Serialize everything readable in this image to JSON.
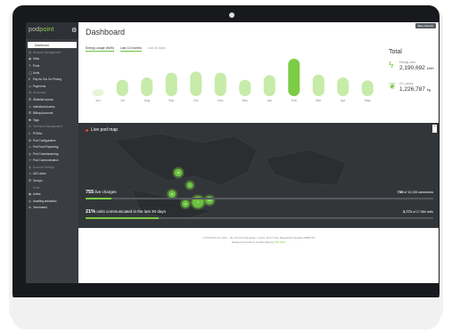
{
  "sidebar": {
    "logo_main": "pod",
    "logo_accent": "point",
    "items": [
      {
        "type": "active",
        "icon": "☐",
        "label": "Dashboard"
      },
      {
        "type": "section",
        "icon": "▤",
        "label": "Network Management"
      },
      {
        "type": "item",
        "icon": "◉",
        "label": "Sites"
      },
      {
        "type": "item",
        "icon": "✎",
        "label": "Pods"
      },
      {
        "type": "item",
        "icon": "◯",
        "label": "Units"
      },
      {
        "type": "item",
        "icon": "£",
        "label": "Pay As You Go Pricing"
      },
      {
        "type": "item",
        "icon": "▭",
        "label": "Payments"
      },
      {
        "type": "section",
        "icon": "▤",
        "label": "All Access"
      },
      {
        "type": "item",
        "icon": "☰",
        "label": "Whitelist Access"
      },
      {
        "type": "item",
        "icon": "☺",
        "label": "Individual Access"
      },
      {
        "type": "item",
        "icon": "☰",
        "label": "Billing Accounts"
      },
      {
        "type": "item",
        "icon": "✱",
        "label": "Tags"
      },
      {
        "type": "section",
        "icon": "⚙",
        "label": "Technical Management"
      },
      {
        "type": "item",
        "icon": "≡",
        "label": "PCBAs"
      },
      {
        "type": "item",
        "icon": "⚙",
        "label": "Pod Configuration"
      },
      {
        "type": "item",
        "icon": "⚠",
        "label": "Pod Fault Reporting"
      },
      {
        "type": "item",
        "icon": "◎",
        "label": "Pod Commissioning"
      },
      {
        "type": "item",
        "icon": "↗",
        "label": "Pod Communication"
      },
      {
        "type": "section",
        "icon": "◉",
        "label": "Account Settings"
      },
      {
        "type": "item",
        "icon": "☺",
        "label": "IAG Users"
      },
      {
        "type": "item",
        "icon": "☰",
        "label": "Groups"
      },
      {
        "type": "section",
        "icon": "◌",
        "label": "Pods"
      },
      {
        "type": "item",
        "icon": "◉",
        "label": "Active"
      },
      {
        "type": "item",
        "icon": "◎",
        "label": "Awaiting activation"
      },
      {
        "type": "item",
        "icon": "⊘",
        "label": "Terminated"
      }
    ]
  },
  "header": {
    "title": "Dashboard",
    "user_button": "Base Network"
  },
  "tabs": [
    {
      "label": "Energy usage (kWh)",
      "active": true
    },
    {
      "label": "Last 12 months",
      "active": true
    },
    {
      "label": "Last 30 days",
      "active": false
    }
  ],
  "chart_data": {
    "type": "bar",
    "categories": [
      "Jun",
      "Jul",
      "Aug",
      "Sep",
      "Oct",
      "Nov",
      "Dec",
      "Jan",
      "Feb",
      "Mar",
      "Apr",
      "May"
    ],
    "values": [
      10,
      28,
      32,
      40,
      42,
      40,
      28,
      36,
      64,
      37,
      32,
      27
    ],
    "highlight_index": 8,
    "ylim": [
      0,
      70
    ],
    "xlabel": "",
    "ylabel": "",
    "colors": {
      "bar": "#c7eba8",
      "highlight": "#7ccc46",
      "faded": "#e6f5d8"
    }
  },
  "totals": {
    "title": "Total",
    "energy": {
      "label": "Energy used",
      "value": "2,190,692",
      "unit": "kWh"
    },
    "co2": {
      "label": "CO₂ saved",
      "value": "1,226,787",
      "unit": "kg"
    }
  },
  "map": {
    "title": "Live pod map",
    "zoom_in": "+",
    "zoom_out": "-",
    "clusters": [
      {
        "label": "48",
        "x": 112,
        "y": 56,
        "r": 4.5
      },
      {
        "label": "34",
        "x": 105,
        "y": 80,
        "r": 4
      },
      {
        "label": "7",
        "x": 125,
        "y": 70,
        "r": 3.5
      },
      {
        "label": "9",
        "x": 134,
        "y": 89,
        "r": 6.5
      },
      {
        "label": "14",
        "x": 147,
        "y": 87,
        "r": 4.5
      },
      {
        "label": "12",
        "x": 120,
        "y": 91,
        "r": 4
      }
    ],
    "stats": [
      {
        "left_value": "755",
        "left_text": "live charges",
        "right_value": "755",
        "right_text": "of 10,105 connectors",
        "fraction": 0.075
      },
      {
        "left_value": "21%",
        "left_text": "units communicated in the last 30 days",
        "right_value": "3,771",
        "right_text": "of 17,964 units",
        "fraction": 0.21
      }
    ]
  },
  "footer": {
    "line1": "© POD Point Ltd, 2014 – 18 | 137-139 Little Essex, London, EC1Y 0YE | Registered in England 06851754",
    "line2_prefix": "Designed and built for confidentiality by ",
    "line2_link": "POD Point"
  }
}
